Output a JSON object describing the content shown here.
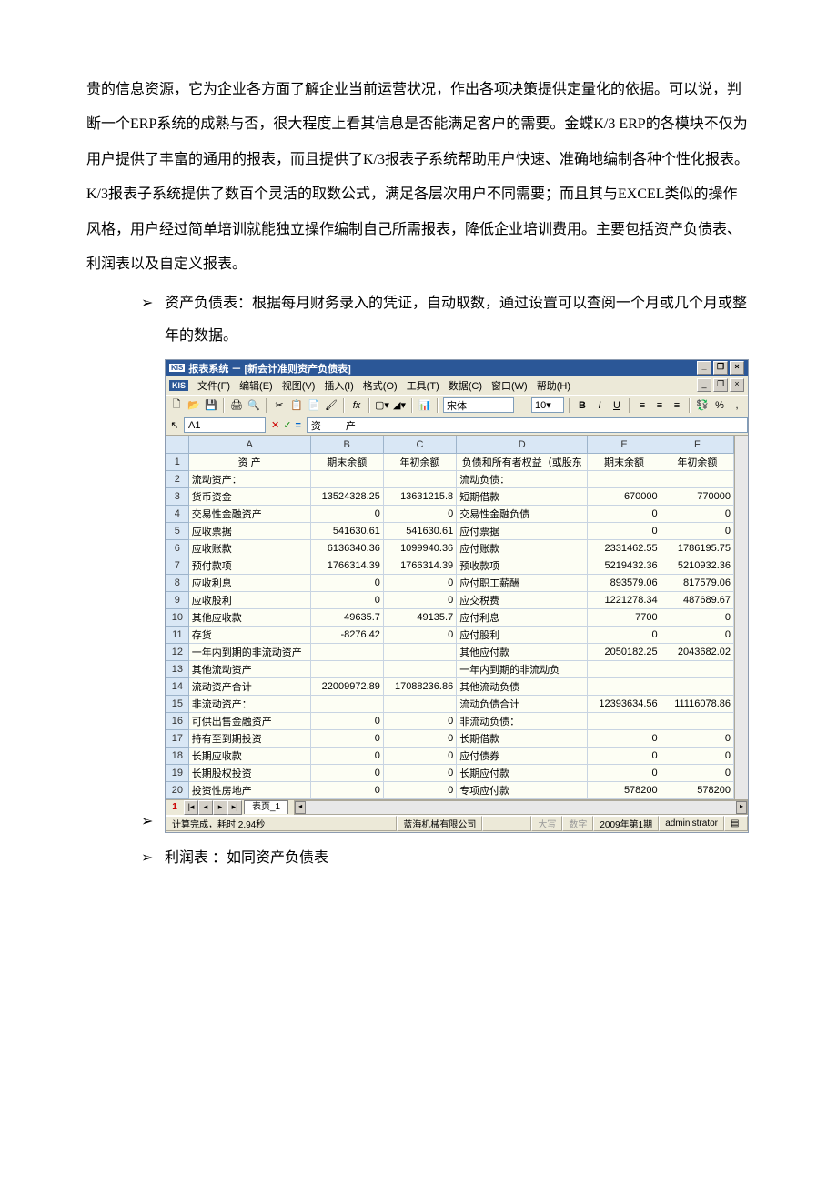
{
  "paragraph": "贵的信息资源，它为企业各方面了解企业当前运营状况，作出各项决策提供定量化的依据。可以说，判断一个ERP系统的成熟与否，很大程度上看其信息是否能满足客户的需要。金蝶K/3 ERP的各模块不仅为用户提供了丰富的通用的报表，而且提供了K/3报表子系统帮助用户快速、准确地编制各种个性化报表。K/3报表子系统提供了数百个灵活的取数公式，满足各层次用户不同需要；而且其与EXCEL类似的操作风格，用户经过简单培训就能独立操作编制自己所需报表，降低企业培训费用。主要包括资产负债表、利润表以及自定义报表。",
  "bullets": [
    "资产负债表：根据每月财务录入的凭证，自动取数，通过设置可以查阅一个月或几个月或整年的数据。",
    "利润表 ：如同资产负债表"
  ],
  "arrow_glyph": "➢",
  "screenshot": {
    "title": "报表系统 － [新会计准则资产负债表]",
    "logo": "KIS",
    "menus": [
      "文件(F)",
      "编辑(E)",
      "视图(V)",
      "插入(I)",
      "格式(O)",
      "工具(T)",
      "数据(C)",
      "窗口(W)",
      "帮助(H)"
    ],
    "font_name": "宋体",
    "font_size": "10",
    "cell_ref": "A1",
    "formula_value": "资      产",
    "col_headers": [
      "A",
      "B",
      "C",
      "D",
      "E",
      "F"
    ],
    "header_row": [
      "资      产",
      "期末余额",
      "年初余额",
      "负债和所有者权益（或股东",
      "期末余额",
      "年初余额"
    ],
    "rows": [
      {
        "n": "2",
        "a": "流动资产：",
        "b": "",
        "c": "",
        "d": "流动负债：",
        "e": "",
        "f": ""
      },
      {
        "n": "3",
        "a": "  货币资金",
        "b": "13524328.25",
        "c": "13631215.8",
        "d": "  短期借款",
        "e": "670000",
        "f": "770000"
      },
      {
        "n": "4",
        "a": "  交易性金融资产",
        "b": "0",
        "c": "0",
        "d": "  交易性金融负债",
        "e": "0",
        "f": "0"
      },
      {
        "n": "5",
        "a": "  应收票据",
        "b": "541630.61",
        "c": "541630.61",
        "d": "  应付票据",
        "e": "0",
        "f": "0"
      },
      {
        "n": "6",
        "a": "  应收账款",
        "b": "6136340.36",
        "c": "1099940.36",
        "d": "  应付账款",
        "e": "2331462.55",
        "f": "1786195.75"
      },
      {
        "n": "7",
        "a": "  预付款项",
        "b": "1766314.39",
        "c": "1766314.39",
        "d": "  预收款项",
        "e": "5219432.36",
        "f": "5210932.36"
      },
      {
        "n": "8",
        "a": "  应收利息",
        "b": "0",
        "c": "0",
        "d": "  应付职工薪酬",
        "e": "893579.06",
        "f": "817579.06"
      },
      {
        "n": "9",
        "a": "  应收股利",
        "b": "0",
        "c": "0",
        "d": "  应交税费",
        "e": "1221278.34",
        "f": "487689.67"
      },
      {
        "n": "10",
        "a": "  其他应收款",
        "b": "49635.7",
        "c": "49135.7",
        "d": "  应付利息",
        "e": "7700",
        "f": "0"
      },
      {
        "n": "11",
        "a": "  存货",
        "b": "-8276.42",
        "c": "0",
        "d": "  应付股利",
        "e": "0",
        "f": "0"
      },
      {
        "n": "12",
        "a": "  一年内到期的非流动资产",
        "b": "",
        "c": "",
        "d": "  其他应付款",
        "e": "2050182.25",
        "f": "2043682.02"
      },
      {
        "n": "13",
        "a": "  其他流动资产",
        "b": "",
        "c": "",
        "d": "  一年内到期的非流动负",
        "e": "",
        "f": ""
      },
      {
        "n": "14",
        "a": "  流动资产合计",
        "b": "22009972.89",
        "c": "17088236.86",
        "d": "  其他流动负债",
        "e": "",
        "f": ""
      },
      {
        "n": "15",
        "a": "非流动资产：",
        "b": "",
        "c": "",
        "d": "  流动负债合计",
        "e": "12393634.56",
        "f": "11116078.86"
      },
      {
        "n": "16",
        "a": "  可供出售金融资产",
        "b": "0",
        "c": "0",
        "d": "非流动负债：",
        "e": "",
        "f": ""
      },
      {
        "n": "17",
        "a": "  持有至到期投资",
        "b": "0",
        "c": "0",
        "d": "  长期借款",
        "e": "0",
        "f": "0"
      },
      {
        "n": "18",
        "a": "  长期应收款",
        "b": "0",
        "c": "0",
        "d": "  应付债券",
        "e": "0",
        "f": "0"
      },
      {
        "n": "19",
        "a": "  长期股权投资",
        "b": "0",
        "c": "0",
        "d": "  长期应付款",
        "e": "0",
        "f": "0"
      },
      {
        "n": "20",
        "a": "  投资性房地产",
        "b": "0",
        "c": "0",
        "d": "  专项应付款",
        "e": "578200",
        "f": "578200"
      }
    ],
    "red_row": "1",
    "sheet_tab": "表页_1",
    "status_left": "计算完成，耗时 2.94秒",
    "status_company": "蓝海机械有限公司",
    "status_caps": "大写",
    "status_num": "数字",
    "status_period": "2009年第1期",
    "status_user": "administrator"
  }
}
